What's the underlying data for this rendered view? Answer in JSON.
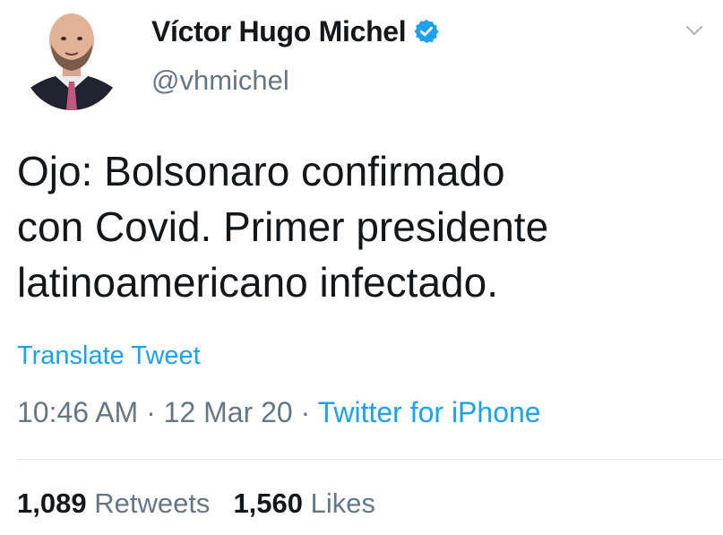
{
  "author": {
    "display_name": "Víctor Hugo Michel",
    "handle": "@vhmichel",
    "verified": true
  },
  "tweet": {
    "text": "Ojo: Bolsonaro confirmado\ncon Covid. Primer presidente\nlatinoamericano infectado.",
    "translate_label": "Translate Tweet",
    "time": "10:46 AM",
    "separator": " · ",
    "date": "12 Mar 20",
    "source": "Twitter for iPhone"
  },
  "stats": {
    "retweets_count": "1,089",
    "retweets_label": "Retweets",
    "likes_count": "1,560",
    "likes_label": "Likes"
  },
  "colors": {
    "link": "#1da1f2",
    "secondary_text": "#657786",
    "primary_text": "#14171a",
    "divider": "#e1e8ed"
  },
  "icons": {
    "verified": "verified-badge-icon",
    "caret": "chevron-down-icon"
  }
}
